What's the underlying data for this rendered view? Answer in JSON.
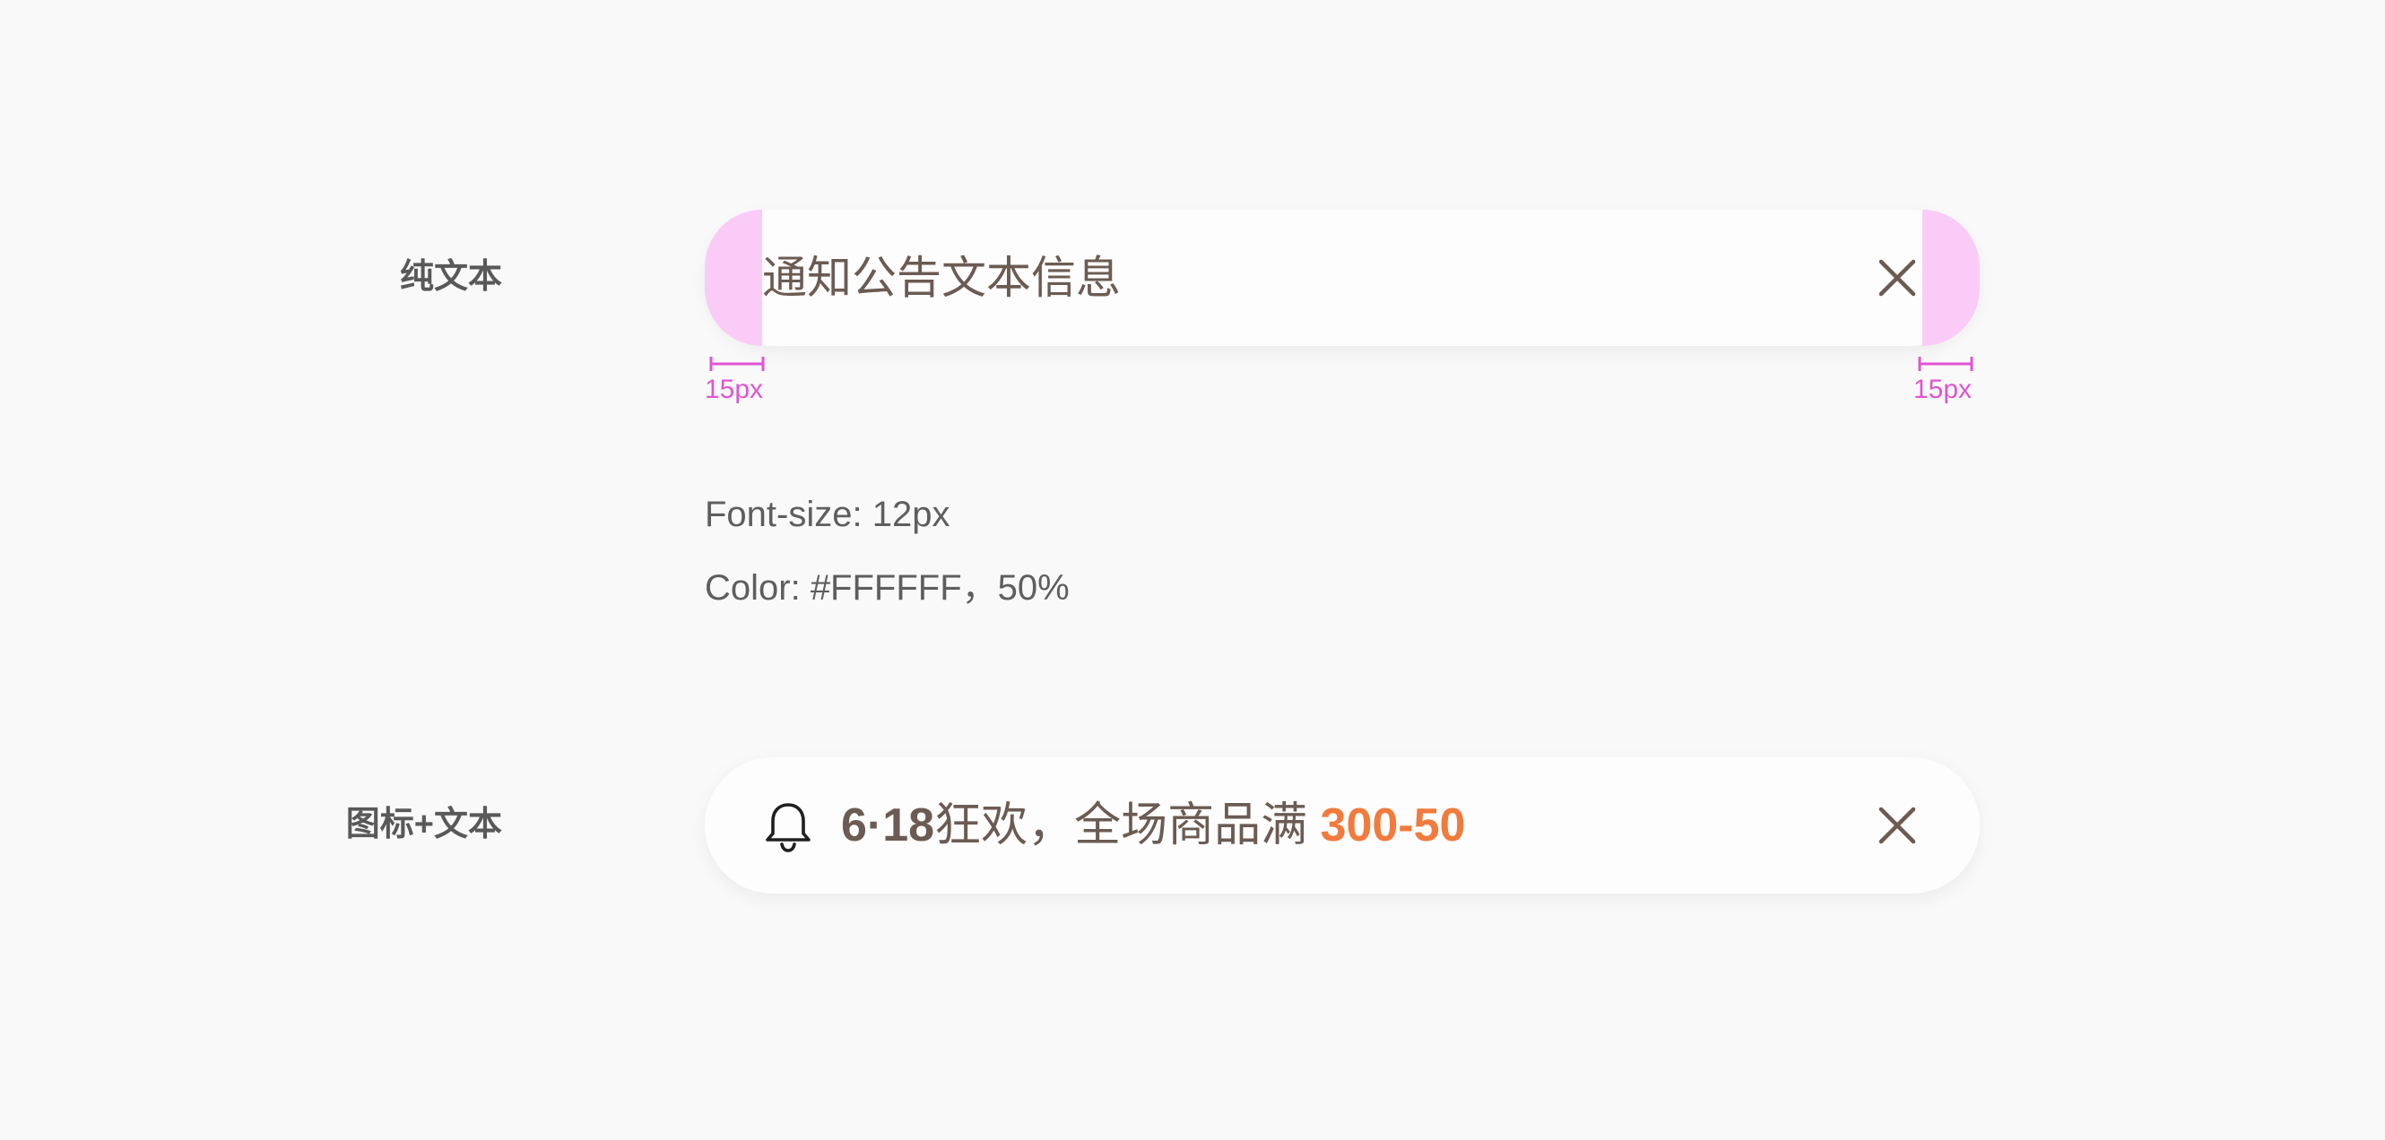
{
  "rows": {
    "plain_text_label": "纯文本",
    "icon_text_label": "图标+文本"
  },
  "notice_plain": {
    "text": "通知公告文本信息",
    "close_icon": "close-icon",
    "padding_left_label": "15px",
    "padding_right_label": "15px"
  },
  "specs": {
    "font_size": "Font-size: 12px",
    "color": "Color: #FFFFFF，50%"
  },
  "notice_promo": {
    "icon": "bell-icon",
    "bold_part": "6·18",
    "text_part": "狂欢，全场商品满 ",
    "accent_part": "300-50",
    "close_icon": "close-icon"
  },
  "colors": {
    "background": "#f9f9f9",
    "bar": "#fdfdfd",
    "padding_highlight": "#fbcbf8",
    "measure": "#e154d3",
    "text": "#6b5b52",
    "accent": "#f27a3c"
  }
}
